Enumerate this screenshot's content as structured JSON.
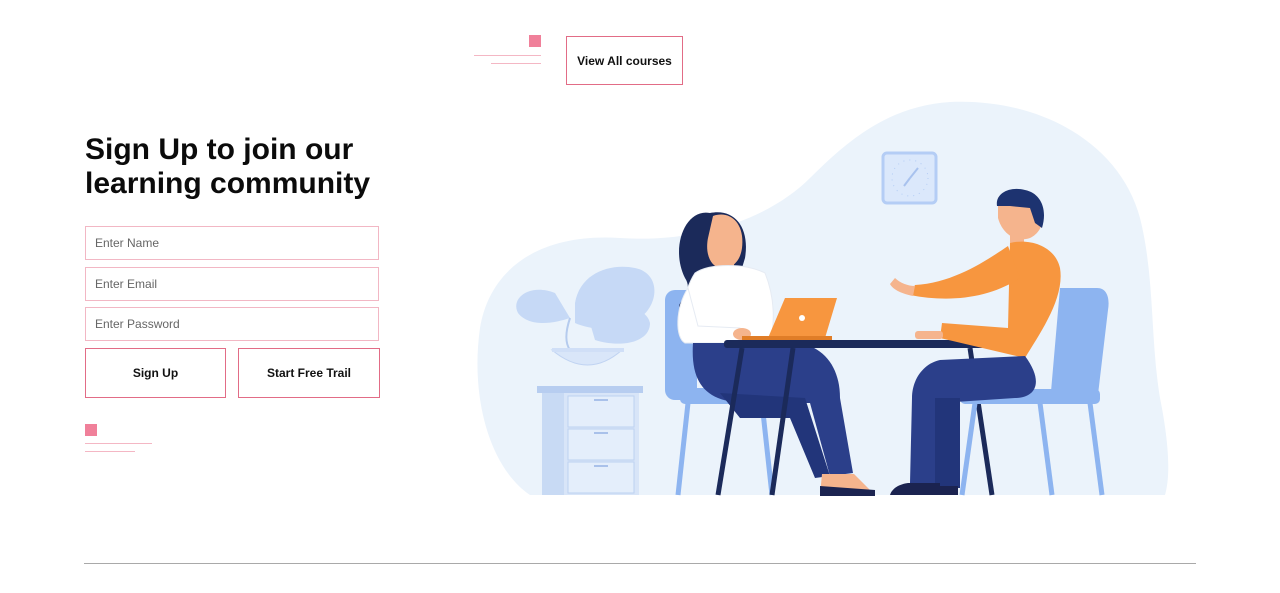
{
  "header": {
    "view_courses_label": "View All courses"
  },
  "signup": {
    "heading": "Sign Up to join our learning community",
    "name_placeholder": "Enter Name",
    "email_placeholder": "Enter Email",
    "password_placeholder": "Enter Password",
    "signup_label": "Sign Up",
    "trial_label": "Start Free Trail"
  },
  "illustration": {
    "subject": "two-people-meeting-at-desk-illustration"
  },
  "colors": {
    "accent_pink": "#f0809a",
    "border_pink": "#e26c86",
    "blob_bg": "#ebf3fb",
    "man_shirt": "#f7963f",
    "pants_navy": "#2b3f8a",
    "chair_blue": "#8db4f0"
  }
}
